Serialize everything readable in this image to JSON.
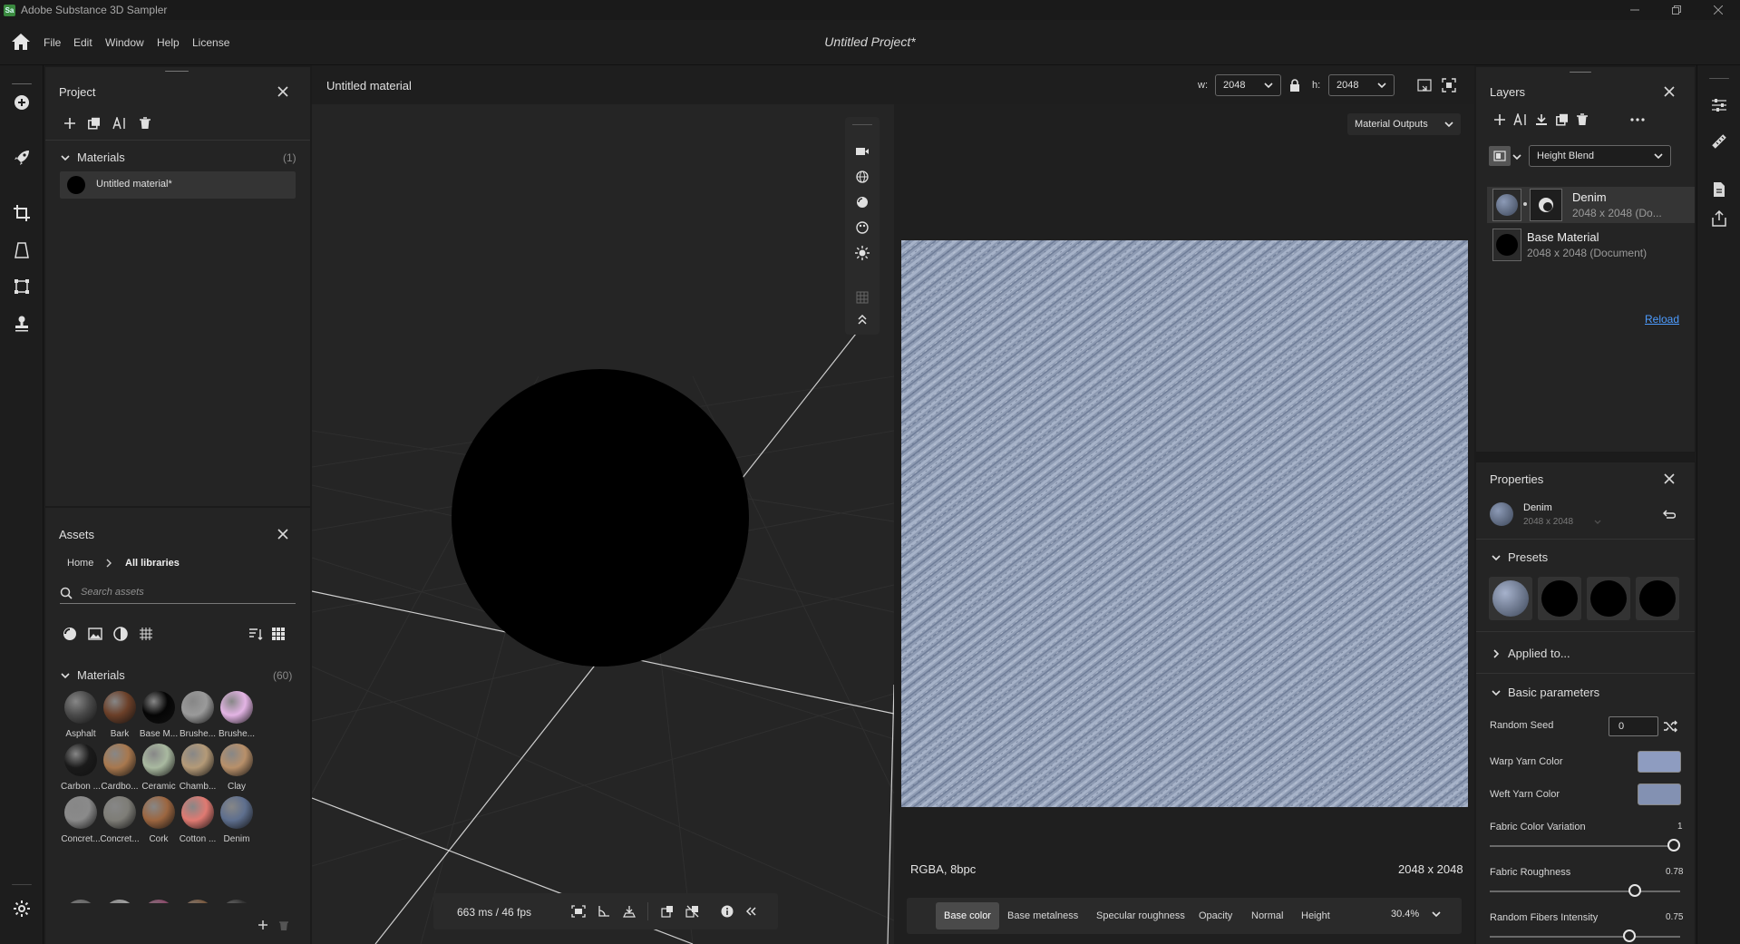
{
  "app": {
    "title": "Adobe Substance 3D Sampler",
    "logo_text": "Sa",
    "project_title": "Untitled Project*"
  },
  "menu": {
    "items": [
      "File",
      "Edit",
      "Window",
      "Help",
      "License"
    ]
  },
  "project_panel": {
    "title": "Project",
    "materials_header": "Materials",
    "materials_count": "(1)",
    "material_item": "Untitled material*"
  },
  "assets_panel": {
    "title": "Assets",
    "breadcrumb_home": "Home",
    "breadcrumb_current": "All libraries",
    "search_placeholder": "Search assets",
    "materials_header": "Materials",
    "materials_count": "(60)",
    "items": [
      {
        "label": "Asphalt",
        "color": "#4a4a4a"
      },
      {
        "label": "Bark",
        "color": "#6b3f28"
      },
      {
        "label": "Base M...",
        "color": "#050505"
      },
      {
        "label": "Brushe...",
        "color": "#9a9a9a"
      },
      {
        "label": "Brushe...",
        "color": "#e3b4e4"
      },
      {
        "label": "Carbon ...",
        "color": "#1a1a1a"
      },
      {
        "label": "Cardbo...",
        "color": "#a8784e"
      },
      {
        "label": "Ceramic",
        "color": "#a9b9a0"
      },
      {
        "label": "Chamb...",
        "color": "#b49a78"
      },
      {
        "label": "Clay",
        "color": "#b8906a"
      },
      {
        "label": "Concret...",
        "color": "#8a8a8a"
      },
      {
        "label": "Concret...",
        "color": "#7e7d77"
      },
      {
        "label": "Cork",
        "color": "#9c6640"
      },
      {
        "label": "Cotton ...",
        "color": "#e07a72"
      },
      {
        "label": "Denim",
        "color": "#5e6f8e"
      }
    ]
  },
  "viewer": {
    "material_name": "Untitled material",
    "w_label": "w:",
    "w_value": "2048",
    "h_label": "h:",
    "h_value": "2048",
    "outputs_dropdown": "Material Outputs",
    "fps": "663 ms / 46 fps",
    "format": "RGBA, 8bpc",
    "resolution": "2048 x 2048",
    "channels": [
      "Base color",
      "Base metalness",
      "Specular roughness",
      "Opacity",
      "Normal",
      "Height"
    ],
    "active_channel": "Base color",
    "zoom": "30.4%"
  },
  "layers_panel": {
    "title": "Layers",
    "blend_mode": "Height Blend",
    "layers": [
      {
        "name": "Denim",
        "info": "2048 x 2048 (Do..."
      },
      {
        "name": "Base Material",
        "info": "2048 x 2048 (Document)"
      }
    ],
    "reload": "Reload"
  },
  "properties_panel": {
    "title": "Properties",
    "layer_name": "Denim",
    "layer_size": "2048 x 2048",
    "presets_header": "Presets",
    "applied_to": "Applied to...",
    "basic_params_header": "Basic parameters",
    "random_seed_label": "Random Seed",
    "random_seed_value": "0",
    "warp_label": "Warp Yarn Color",
    "warp_color": "#8e9cc0",
    "weft_label": "Weft Yarn Color",
    "weft_color": "#8391b2",
    "fabric_color_variation_label": "Fabric Color Variation",
    "fabric_color_variation_value": "1",
    "fabric_roughness_label": "Fabric Roughness",
    "fabric_roughness_value": "0.78",
    "random_fibers_label": "Random Fibers Intensity",
    "random_fibers_value": "0.75"
  }
}
